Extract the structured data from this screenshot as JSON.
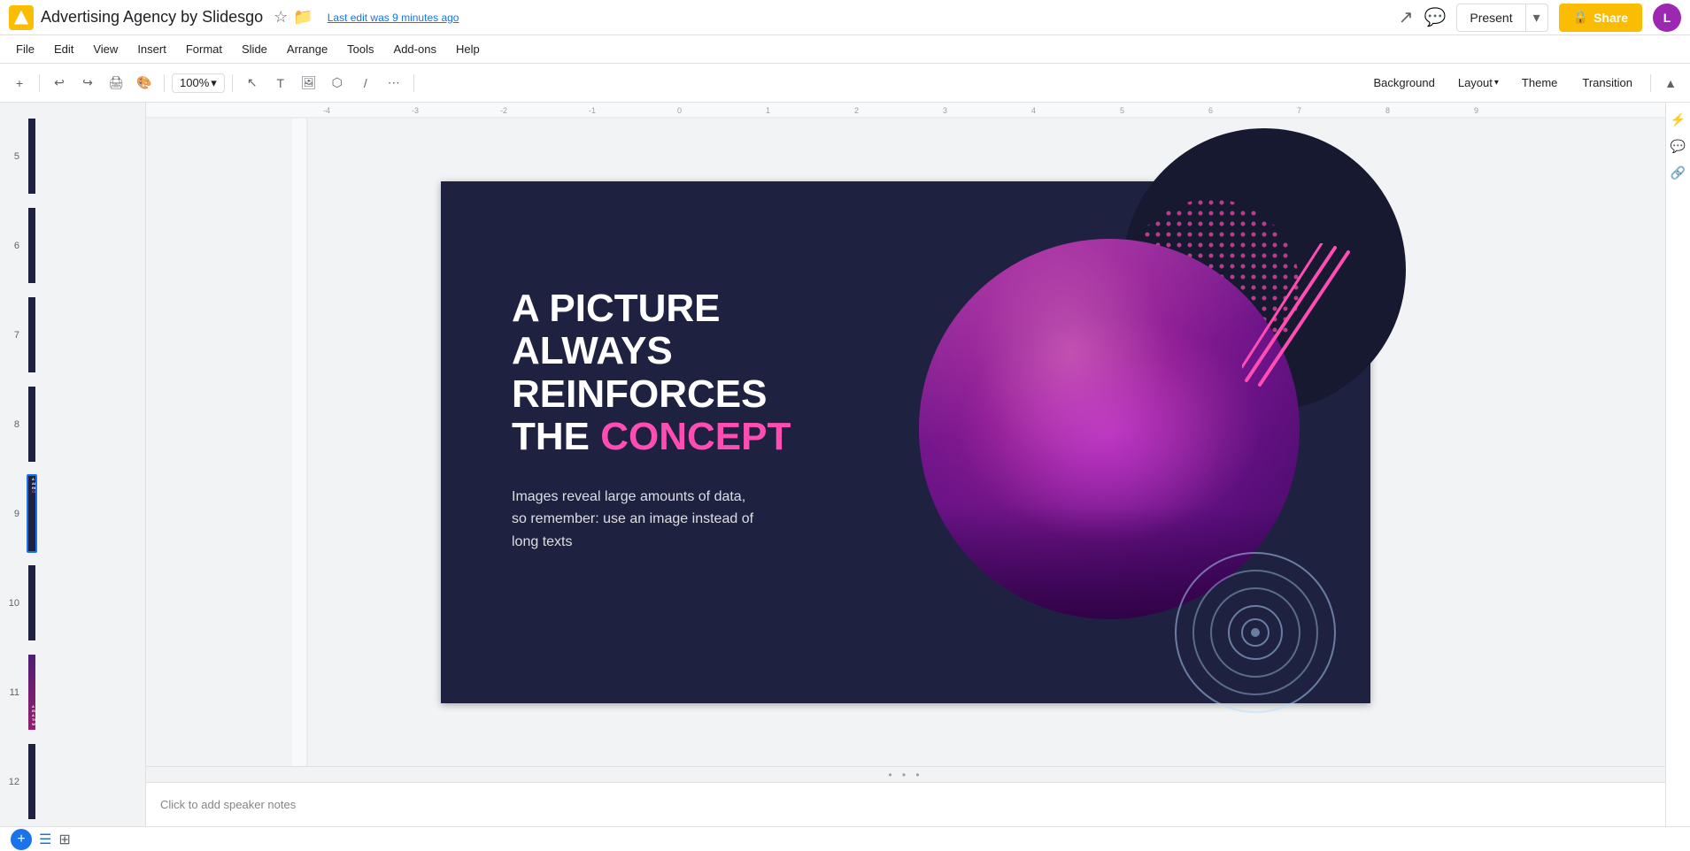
{
  "app": {
    "icon_color": "#FBBC04",
    "title": "Advertising Agency by Slidesgo",
    "star_icon": "☆",
    "folder_icon": "📁",
    "edit_status": "Last edit was 9 minutes ago"
  },
  "topbar": {
    "trend_icon": "↗",
    "comment_icon": "💬",
    "present_label": "Present",
    "share_label": "Share",
    "avatar_initials": "L"
  },
  "menubar": {
    "items": [
      "File",
      "Edit",
      "View",
      "Insert",
      "Format",
      "Slide",
      "Arrange",
      "Tools",
      "Add-ons",
      "Help"
    ]
  },
  "toolbar": {
    "zoom_label": "100%",
    "background_label": "Background",
    "layout_label": "Layout",
    "theme_label": "Theme",
    "transition_label": "Transition"
  },
  "slide_panel": {
    "slides": [
      {
        "number": "5",
        "bg": "#1e2140"
      },
      {
        "number": "6",
        "bg": "#1e2140"
      },
      {
        "number": "7",
        "bg": "#1e2140"
      },
      {
        "number": "8",
        "bg": "#1e2140"
      },
      {
        "number": "9",
        "bg": "#1e2140",
        "active": true
      },
      {
        "number": "10",
        "bg": "#1e2140"
      },
      {
        "number": "11",
        "bg": "#1e2140"
      },
      {
        "number": "12",
        "bg": "#1e2140"
      }
    ]
  },
  "slide": {
    "headline_line1": "A PICTURE",
    "headline_line2": "ALWAYS",
    "headline_line3": "REINFORCES",
    "headline_line4_white": "THE",
    "headline_line4_pink": "CONCEPT",
    "subtext": "Images reveal large amounts of data, so remember: use an image instead of long texts"
  },
  "speaker_notes": {
    "placeholder": "Click to add speaker notes"
  },
  "bottom_bar": {
    "grid_icon": "⊞",
    "list_icon": "☰",
    "add_icon": "+"
  }
}
